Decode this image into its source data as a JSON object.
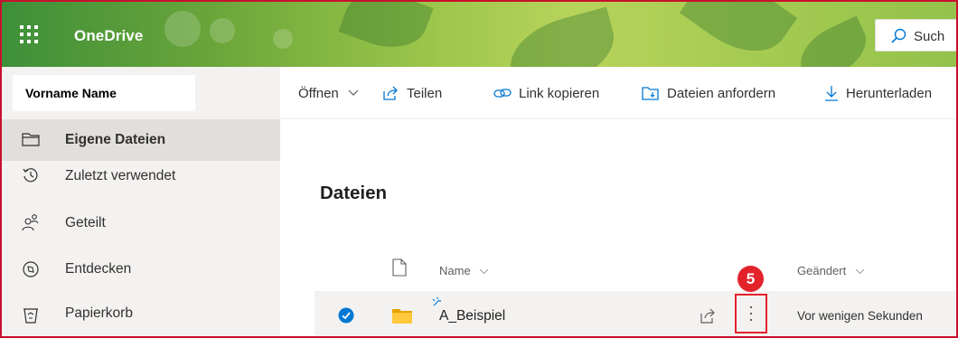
{
  "header": {
    "app_title": "OneDrive",
    "search_label": "Such"
  },
  "user": {
    "name": "Vorname Name"
  },
  "commandbar": {
    "open": "Öffnen",
    "share": "Teilen",
    "copy_link": "Link kopieren",
    "request_files": "Dateien anfordern",
    "download": "Herunterladen"
  },
  "leftnav": {
    "items": [
      {
        "label": "Eigene Dateien",
        "icon": "folder-icon",
        "active": true
      },
      {
        "label": "Zuletzt verwendet",
        "icon": "recent-icon"
      },
      {
        "label": "Geteilt",
        "icon": "shared-icon"
      },
      {
        "label": "Entdecken",
        "icon": "discover-icon"
      },
      {
        "label": "Papierkorb",
        "icon": "recycle-bin-icon"
      }
    ]
  },
  "main": {
    "title": "Dateien",
    "columns": {
      "name": "Name",
      "modified": "Geändert"
    },
    "files": [
      {
        "name": "A_Beispiel",
        "type": "folder",
        "modified": "Vor wenigen Sekunden",
        "selected": true
      }
    ]
  },
  "annotation": {
    "step": "5"
  },
  "colors": {
    "accent": "#0078d4",
    "highlight": "#e3232b",
    "folder": "#ffb900"
  }
}
